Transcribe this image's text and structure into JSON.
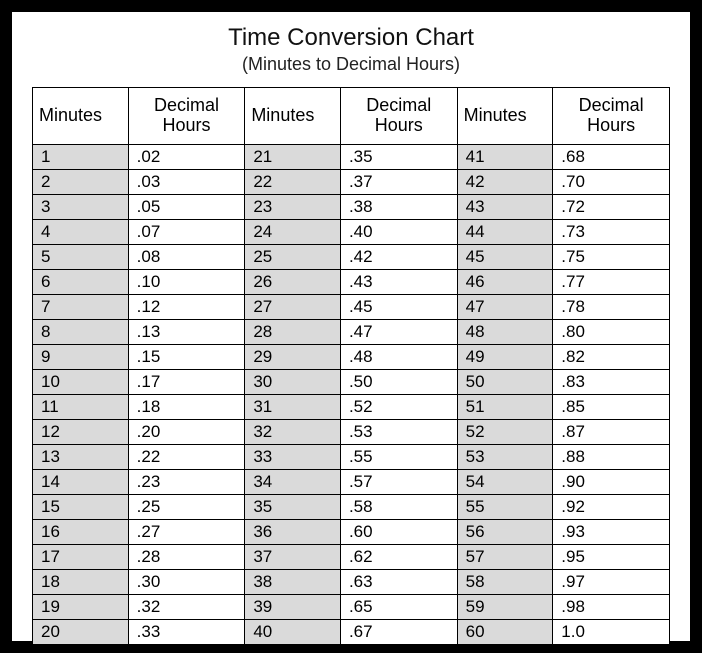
{
  "title": "Time Conversion Chart",
  "subtitle": "(Minutes to Decimal Hours)",
  "headers": {
    "minutes": "Minutes",
    "decimal": "Decimal Hours"
  },
  "columns": [
    [
      {
        "m": "1",
        "d": ".02"
      },
      {
        "m": "2",
        "d": ".03"
      },
      {
        "m": "3",
        "d": ".05"
      },
      {
        "m": "4",
        "d": ".07"
      },
      {
        "m": "5",
        "d": ".08"
      },
      {
        "m": "6",
        "d": ".10"
      },
      {
        "m": "7",
        "d": ".12"
      },
      {
        "m": "8",
        "d": ".13"
      },
      {
        "m": "9",
        "d": ".15"
      },
      {
        "m": "10",
        "d": ".17"
      },
      {
        "m": "11",
        "d": ".18"
      },
      {
        "m": "12",
        "d": ".20"
      },
      {
        "m": "13",
        "d": ".22"
      },
      {
        "m": "14",
        "d": ".23"
      },
      {
        "m": "15",
        "d": ".25"
      },
      {
        "m": "16",
        "d": ".27"
      },
      {
        "m": "17",
        "d": ".28"
      },
      {
        "m": "18",
        "d": ".30"
      },
      {
        "m": "19",
        "d": ".32"
      },
      {
        "m": "20",
        "d": ".33"
      }
    ],
    [
      {
        "m": "21",
        "d": ".35"
      },
      {
        "m": "22",
        "d": ".37"
      },
      {
        "m": "23",
        "d": ".38"
      },
      {
        "m": "24",
        "d": ".40"
      },
      {
        "m": "25",
        "d": ".42"
      },
      {
        "m": "26",
        "d": ".43"
      },
      {
        "m": "27",
        "d": ".45"
      },
      {
        "m": "28",
        "d": ".47"
      },
      {
        "m": "29",
        "d": ".48"
      },
      {
        "m": "30",
        "d": ".50"
      },
      {
        "m": "31",
        "d": ".52"
      },
      {
        "m": "32",
        "d": ".53"
      },
      {
        "m": "33",
        "d": ".55"
      },
      {
        "m": "34",
        "d": ".57"
      },
      {
        "m": "35",
        "d": ".58"
      },
      {
        "m": "36",
        "d": ".60"
      },
      {
        "m": "37",
        "d": ".62"
      },
      {
        "m": "38",
        "d": ".63"
      },
      {
        "m": "39",
        "d": ".65"
      },
      {
        "m": "40",
        "d": ".67"
      }
    ],
    [
      {
        "m": "41",
        "d": ".68"
      },
      {
        "m": "42",
        "d": ".70"
      },
      {
        "m": "43",
        "d": ".72"
      },
      {
        "m": "44",
        "d": ".73"
      },
      {
        "m": "45",
        "d": ".75"
      },
      {
        "m": "46",
        "d": ".77"
      },
      {
        "m": "47",
        "d": ".78"
      },
      {
        "m": "48",
        "d": ".80"
      },
      {
        "m": "49",
        "d": ".82"
      },
      {
        "m": "50",
        "d": ".83"
      },
      {
        "m": "51",
        "d": ".85"
      },
      {
        "m": "52",
        "d": ".87"
      },
      {
        "m": "53",
        "d": ".88"
      },
      {
        "m": "54",
        "d": ".90"
      },
      {
        "m": "55",
        "d": ".92"
      },
      {
        "m": "56",
        "d": ".93"
      },
      {
        "m": "57",
        "d": ".95"
      },
      {
        "m": "58",
        "d": ".97"
      },
      {
        "m": "59",
        "d": ".98"
      },
      {
        "m": "60",
        "d": "1.0"
      }
    ]
  ],
  "chart_data": {
    "type": "table",
    "title": "Time Conversion Chart (Minutes to Decimal Hours)",
    "columns": [
      "Minutes",
      "Decimal Hours"
    ],
    "rows": [
      [
        1,
        0.02
      ],
      [
        2,
        0.03
      ],
      [
        3,
        0.05
      ],
      [
        4,
        0.07
      ],
      [
        5,
        0.08
      ],
      [
        6,
        0.1
      ],
      [
        7,
        0.12
      ],
      [
        8,
        0.13
      ],
      [
        9,
        0.15
      ],
      [
        10,
        0.17
      ],
      [
        11,
        0.18
      ],
      [
        12,
        0.2
      ],
      [
        13,
        0.22
      ],
      [
        14,
        0.23
      ],
      [
        15,
        0.25
      ],
      [
        16,
        0.27
      ],
      [
        17,
        0.28
      ],
      [
        18,
        0.3
      ],
      [
        19,
        0.32
      ],
      [
        20,
        0.33
      ],
      [
        21,
        0.35
      ],
      [
        22,
        0.37
      ],
      [
        23,
        0.38
      ],
      [
        24,
        0.4
      ],
      [
        25,
        0.42
      ],
      [
        26,
        0.43
      ],
      [
        27,
        0.45
      ],
      [
        28,
        0.47
      ],
      [
        29,
        0.48
      ],
      [
        30,
        0.5
      ],
      [
        31,
        0.52
      ],
      [
        32,
        0.53
      ],
      [
        33,
        0.55
      ],
      [
        34,
        0.57
      ],
      [
        35,
        0.58
      ],
      [
        36,
        0.6
      ],
      [
        37,
        0.62
      ],
      [
        38,
        0.63
      ],
      [
        39,
        0.65
      ],
      [
        40,
        0.67
      ],
      [
        41,
        0.68
      ],
      [
        42,
        0.7
      ],
      [
        43,
        0.72
      ],
      [
        44,
        0.73
      ],
      [
        45,
        0.75
      ],
      [
        46,
        0.77
      ],
      [
        47,
        0.78
      ],
      [
        48,
        0.8
      ],
      [
        49,
        0.82
      ],
      [
        50,
        0.83
      ],
      [
        51,
        0.85
      ],
      [
        52,
        0.87
      ],
      [
        53,
        0.88
      ],
      [
        54,
        0.9
      ],
      [
        55,
        0.92
      ],
      [
        56,
        0.93
      ],
      [
        57,
        0.95
      ],
      [
        58,
        0.97
      ],
      [
        59,
        0.98
      ],
      [
        60,
        1.0
      ]
    ]
  }
}
